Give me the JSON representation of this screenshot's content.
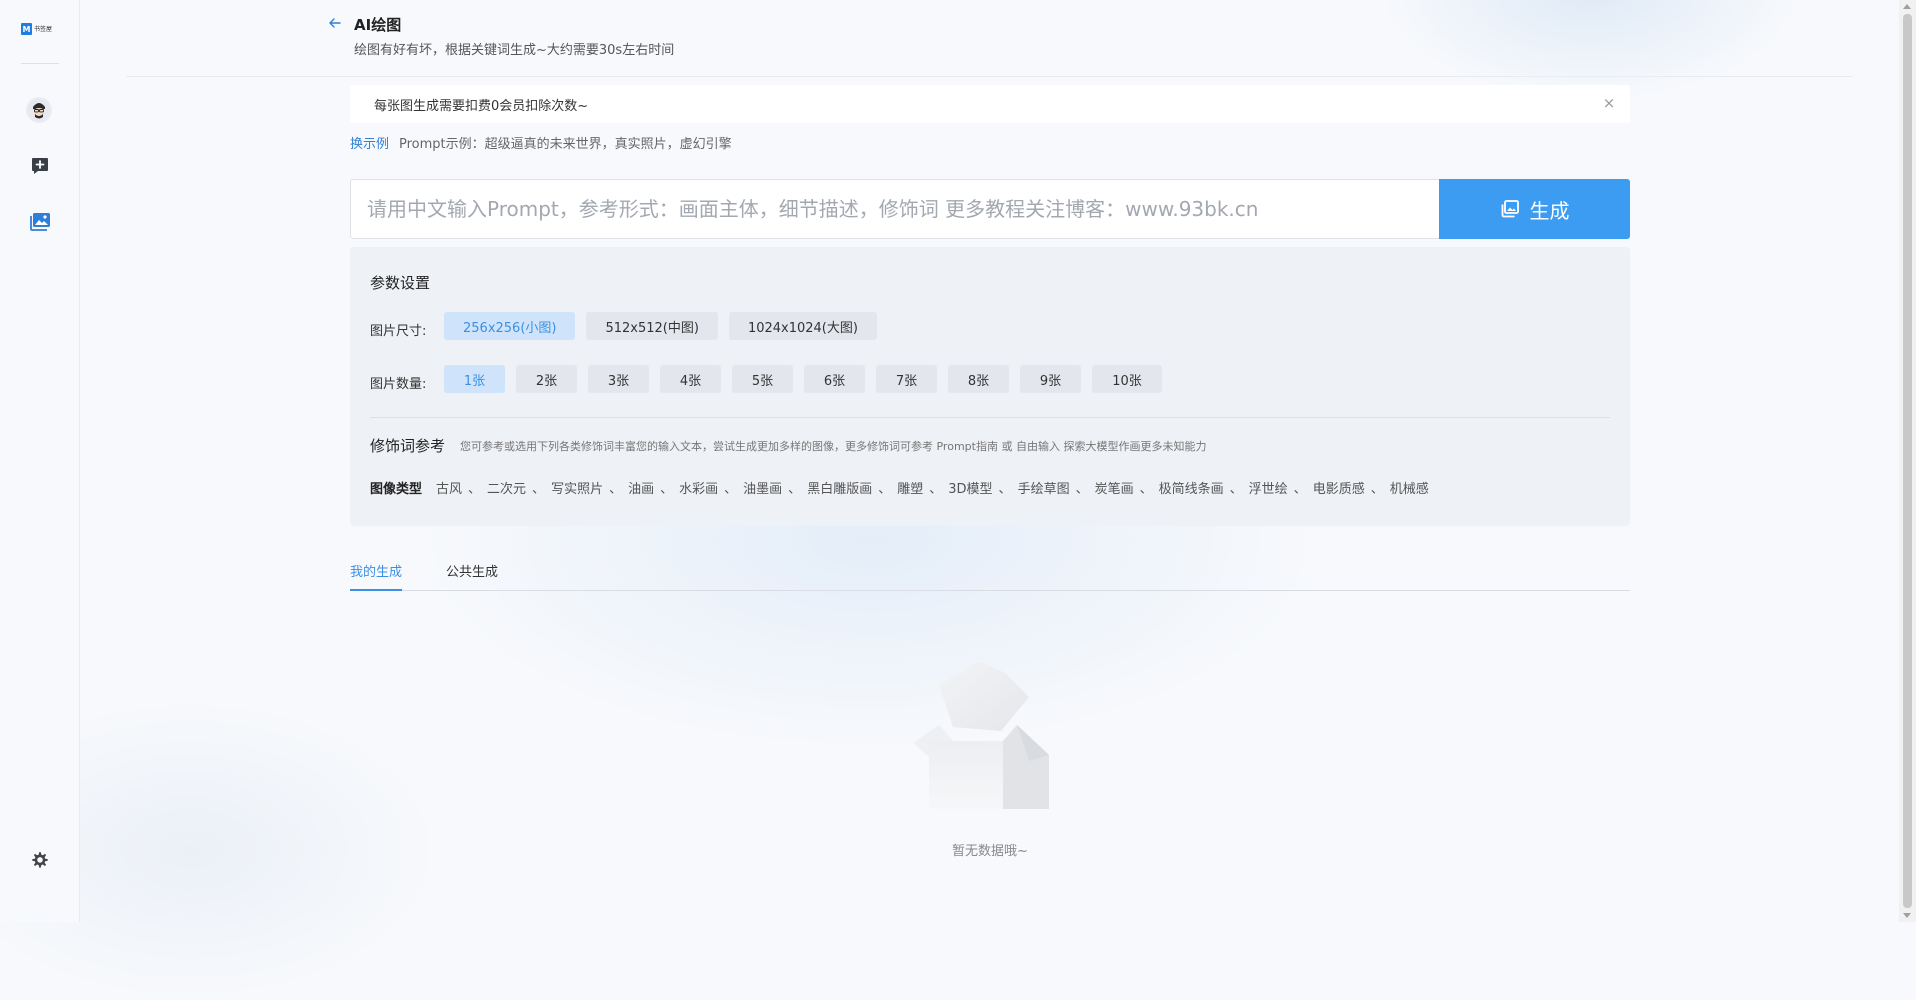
{
  "sidebar": {
    "logo_mark": "M",
    "logo_text": "书签屋",
    "nav": [
      {
        "name": "avatar"
      },
      {
        "name": "chat-add-icon"
      },
      {
        "name": "gallery-icon",
        "active": true
      }
    ],
    "settings_icon": "gear-icon"
  },
  "header": {
    "title": "AI绘图",
    "subtitle": "绘图有好有坏，根据关键词生成~大约需要30s左右时间"
  },
  "notice": {
    "text": "每张图生成需要扣费0会员扣除次数~",
    "close": "×"
  },
  "example": {
    "link": "换示例",
    "text": "Prompt示例：超级逼真的未来世界，真实照片，虚幻引擎"
  },
  "prompt": {
    "placeholder": "请用中文输入Prompt，参考形式：画面主体，细节描述，修饰词 更多教程关注博客：www.93bk.cn",
    "value": "",
    "button_label": "生成"
  },
  "params": {
    "title": "参数设置",
    "size_label": "图片尺寸:",
    "sizes": [
      "256x256(小图)",
      "512x512(中图)",
      "1024x1024(大图)"
    ],
    "size_selected": 0,
    "count_label": "图片数量:",
    "counts": [
      "1张",
      "2张",
      "3张",
      "4张",
      "5张",
      "6张",
      "7张",
      "8张",
      "9张",
      "10张"
    ],
    "count_selected": 0
  },
  "modifiers": {
    "title": "修饰词参考",
    "desc": "您可参考或选用下列各类修饰词丰富您的输入文本，尝试生成更加多样的图像，更多修饰词可参考 Prompt指南 或 自由输入 探索大模型作画更多未知能力",
    "type_label": "图像类型",
    "types": [
      "古风",
      "二次元",
      "写实照片",
      "油画",
      "水彩画",
      "油墨画",
      "黑白雕版画",
      "雕塑",
      "3D模型",
      "手绘草图",
      "炭笔画",
      "极简线条画",
      "浮世绘",
      "电影质感",
      "机械感"
    ]
  },
  "tabs": {
    "items": [
      "我的生成",
      "公共生成"
    ],
    "active": 0
  },
  "empty": {
    "text": "暂无数据哦~"
  },
  "colors": {
    "accent": "#3c9cf2",
    "selected_bg": "#cfe4fb",
    "selected_text": "#3d8fe4",
    "panel_bg": "#eef1f6",
    "page_bg": "#f7f9fc"
  }
}
